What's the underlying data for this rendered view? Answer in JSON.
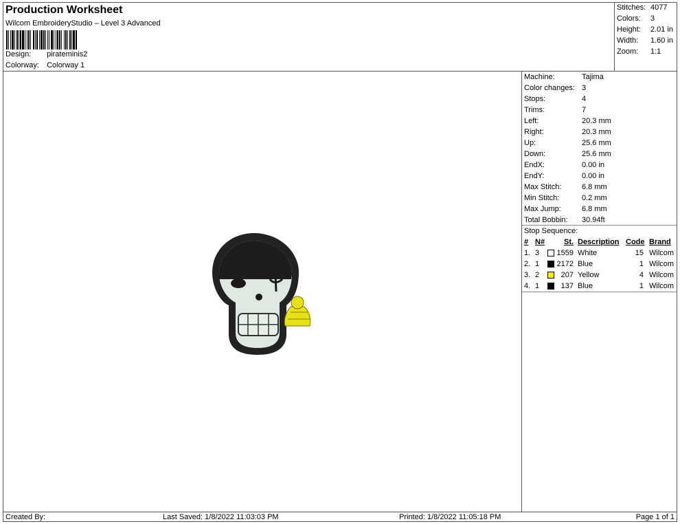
{
  "header": {
    "title": "Production Worksheet",
    "subtitle": "Wilcom EmbroideryStudio – Level 3 Advanced",
    "design_label": "Design:",
    "design_value": "pirateminis2",
    "colorway_label": "Colorway:",
    "colorway_value": "Colorway 1"
  },
  "stats": {
    "stitches_label": "Stitches:",
    "stitches_value": "4077",
    "colors_label": "Colors:",
    "colors_value": "3",
    "height_label": "Height:",
    "height_value": "2.01 in",
    "width_label": "Width:",
    "width_value": "1.60 in",
    "zoom_label": "Zoom:",
    "zoom_value": "1:1"
  },
  "machine_info": [
    {
      "label": "Machine:",
      "value": "Tajima"
    },
    {
      "label": "Color changes:",
      "value": "3"
    },
    {
      "label": "Stops:",
      "value": "4"
    },
    {
      "label": "Trims:",
      "value": "7"
    },
    {
      "label": "Left:",
      "value": "20.3 mm"
    },
    {
      "label": "Right:",
      "value": "20.3 mm"
    },
    {
      "label": "Up:",
      "value": "25.6 mm"
    },
    {
      "label": "Down:",
      "value": "25.6 mm"
    },
    {
      "label": "EndX:",
      "value": "0.00 in"
    },
    {
      "label": "EndY:",
      "value": "0.00 in"
    },
    {
      "label": "Max Stitch:",
      "value": "6.8 mm"
    },
    {
      "label": "Min Stitch:",
      "value": "0.2 mm"
    },
    {
      "label": "Max Jump:",
      "value": "6.8 mm"
    },
    {
      "label": "Total Bobbin:",
      "value": "30.94ft"
    }
  ],
  "stop_sequence": {
    "title": "Stop Sequence:",
    "columns": {
      "num": "#",
      "n": "N#",
      "st": "St.",
      "description": "Description",
      "code": "Code",
      "brand": "Brand"
    },
    "rows": [
      {
        "num": "1.",
        "n": "3",
        "color": "#ffffff",
        "st": "1559",
        "description": "White",
        "code": "15",
        "brand": "Wilcom"
      },
      {
        "num": "2.",
        "n": "1",
        "color": "#000000",
        "st": "2172",
        "description": "Blue",
        "code": "1",
        "brand": "Wilcom"
      },
      {
        "num": "3.",
        "n": "2",
        "color": "#ffee00",
        "st": "207",
        "description": "Yellow",
        "code": "4",
        "brand": "Wilcom"
      },
      {
        "num": "4.",
        "n": "1",
        "color": "#000000",
        "st": "137",
        "description": "Blue",
        "code": "1",
        "brand": "Wilcom"
      }
    ]
  },
  "footer": {
    "created_by": "Created By:",
    "last_saved": "Last Saved: 1/8/2022 11:03:03 PM",
    "printed": "Printed: 1/8/2022 11:05:18 PM",
    "page": "Page 1 of 1"
  }
}
